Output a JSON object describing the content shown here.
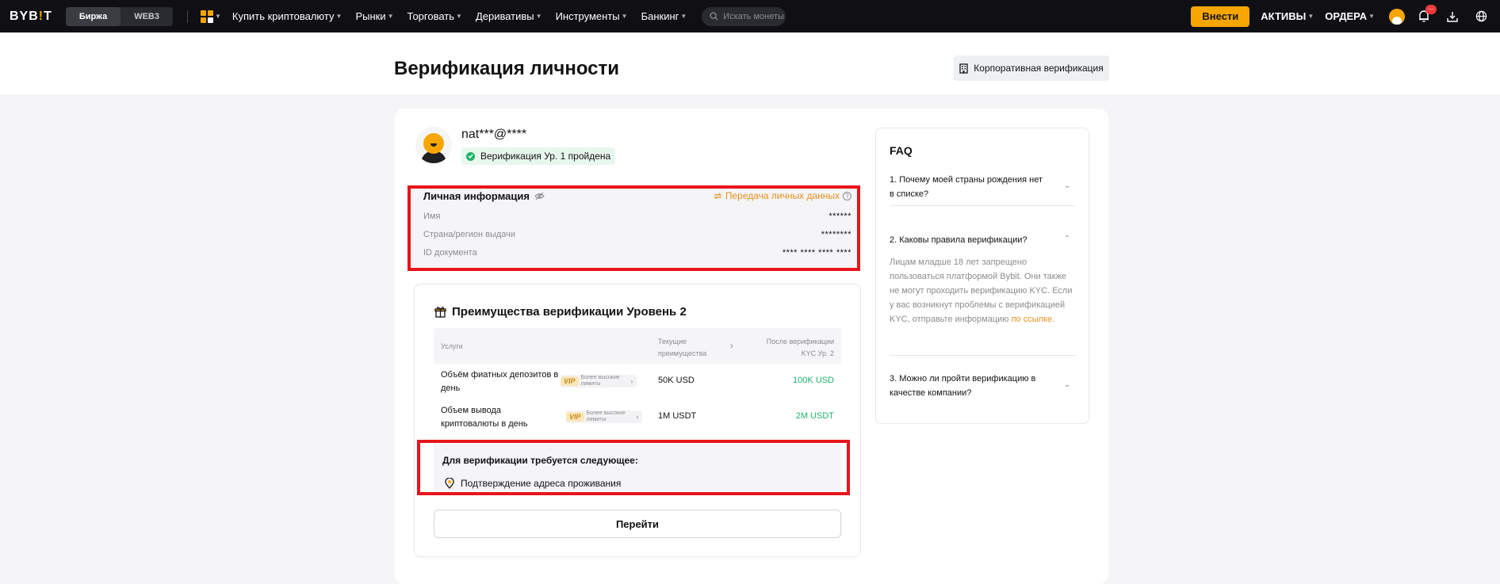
{
  "nav": {
    "logo_main": "BYB",
    "logo_accent": "!",
    "logo_tail": "T",
    "mode_exchange": "Биржа",
    "mode_web3": "WEB3",
    "items": [
      {
        "label": "Купить криптовалюту"
      },
      {
        "label": "Рынки"
      },
      {
        "label": "Торговать"
      },
      {
        "label": "Деривативы"
      },
      {
        "label": "Инструменты"
      },
      {
        "label": "Банкинг"
      }
    ],
    "search_placeholder": "Искать монеты",
    "deposit": "Внести",
    "assets": "АКТИВЫ",
    "orders": "ОРДЕРА",
    "notification_count": "···"
  },
  "header": {
    "title": "Верификация личности",
    "corporate_button": "Корпоративная верификация"
  },
  "user": {
    "name": "nat***@****",
    "status": "Верификация Ур. 1 пройдена"
  },
  "personal_info": {
    "title": "Личная информация",
    "transfer_link": "Передача личных данных",
    "rows": [
      {
        "label": "Имя",
        "value": "******"
      },
      {
        "label": "Страна/регион выдачи",
        "value": "********"
      },
      {
        "label": "ID документа",
        "value": "**** **** **** ****"
      }
    ]
  },
  "benefits": {
    "title": "Преимущества верификации Уровень 2",
    "col_service": "Услуги",
    "col_current_1": "Текущие",
    "col_current_2": "преимущества",
    "col_after_1": "После верификации",
    "col_after_2": "KYC Ур. 2",
    "rows": [
      {
        "service": "Объём фиатных депозитов в день",
        "vip": "VIP",
        "hint": "Более высокие лимиты",
        "current": "50K USD",
        "after": "100K USD"
      },
      {
        "service": "Объем вывода криптовалюты в день",
        "vip": "VIP",
        "hint": "Более высокие лимиты",
        "current": "1M USDT",
        "after": "2M USDT"
      }
    ],
    "requirements_title": "Для верификации требуется следующее:",
    "requirement": "Подтверждение адреса проживания",
    "go_button": "Перейти"
  },
  "faq": {
    "title": "FAQ",
    "q1": "1. Почему моей страны рождения нет в списке?",
    "q2": "2. Каковы правила верификации?",
    "a2_text": "Лицам младше 18 лет запрещено пользоваться платформой Bybit. Они также не могут проходить верификацию KYC. Если у вас возникнут проблемы с верификацией KYC, отправьте информацию ",
    "a2_link": "по ссылке.",
    "q3": "3. Можно ли пройти верификацию в качестве компании?"
  },
  "colors": {
    "accent": "#f7a600",
    "success": "#20b26c",
    "link": "#e5901c",
    "highlight": "#e8141b"
  }
}
